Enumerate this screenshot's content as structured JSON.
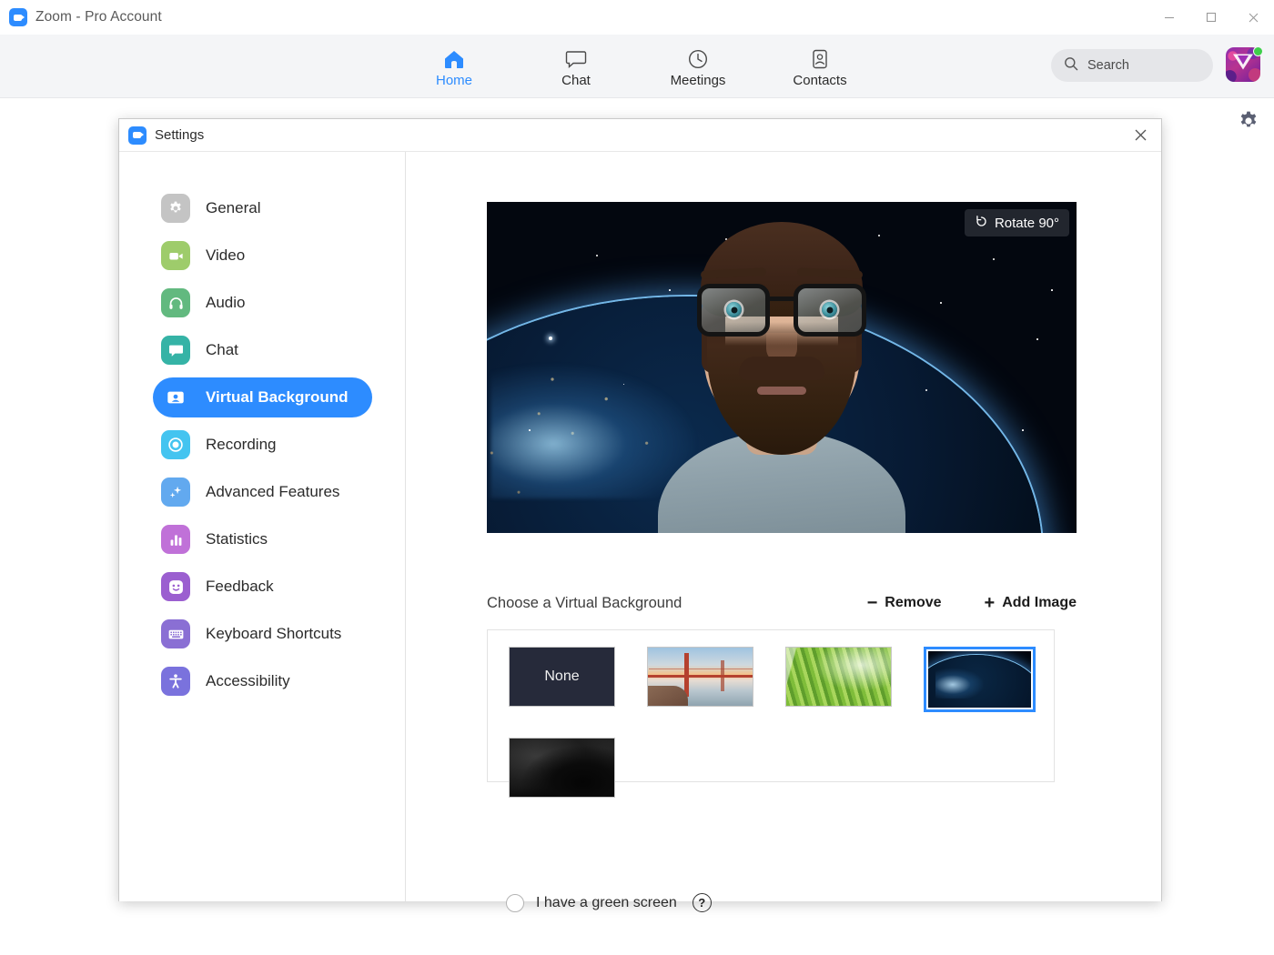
{
  "window": {
    "title": "Zoom - Pro Account",
    "minimize_label": "Minimize",
    "maximize_label": "Maximize",
    "close_label": "Close"
  },
  "nav": {
    "tabs": [
      {
        "label": "Home",
        "icon": "home-icon",
        "active": true
      },
      {
        "label": "Chat",
        "icon": "chat-bubble-icon",
        "active": false
      },
      {
        "label": "Meetings",
        "icon": "clock-icon",
        "active": false
      },
      {
        "label": "Contacts",
        "icon": "contact-card-icon",
        "active": false
      }
    ],
    "search": {
      "placeholder": "Search",
      "value": ""
    },
    "avatar": {
      "name": "user-avatar",
      "status": "available"
    },
    "gear_label": "Settings"
  },
  "dialog": {
    "title": "Settings",
    "close_label": "Close",
    "sidebar": [
      {
        "label": "General",
        "icon": "gear-icon",
        "color": "#c4c4c4",
        "active": false
      },
      {
        "label": "Video",
        "icon": "video-camera-icon",
        "color": "#9ecc6b",
        "active": false
      },
      {
        "label": "Audio",
        "icon": "headphones-icon",
        "color": "#62b97f",
        "active": false
      },
      {
        "label": "Chat",
        "icon": "chat-bubble-icon",
        "color": "#35b3a6",
        "active": false
      },
      {
        "label": "Virtual Background",
        "icon": "person-card-icon",
        "color": "#2D8CFF",
        "active": true
      },
      {
        "label": "Recording",
        "icon": "record-circle-icon",
        "color": "#44c4f0",
        "active": false
      },
      {
        "label": "Advanced Features",
        "icon": "sparkles-icon",
        "color": "#62a9ef",
        "active": false
      },
      {
        "label": "Statistics",
        "icon": "bar-chart-icon",
        "color": "#c071d8",
        "active": false
      },
      {
        "label": "Feedback",
        "icon": "smiley-face-icon",
        "color": "#9b5fd0",
        "active": false
      },
      {
        "label": "Keyboard Shortcuts",
        "icon": "keyboard-icon",
        "color": "#8a6fd4",
        "active": false
      },
      {
        "label": "Accessibility",
        "icon": "accessibility-icon",
        "color": "#7a72dd",
        "active": false
      }
    ],
    "preview": {
      "rotate_label": "Rotate 90°",
      "rotate_icon": "rotate-ccw-icon",
      "description": "Self-view video preview with space/Earth virtual background applied"
    },
    "choose_label": "Choose a Virtual Background",
    "remove": {
      "label": "Remove",
      "sign": "−"
    },
    "add_image": {
      "label": "Add Image",
      "sign": "+"
    },
    "backgrounds": [
      {
        "name": "none",
        "label": "None",
        "style": "thumb-none",
        "selected": false
      },
      {
        "name": "bridge",
        "label": "",
        "style": "thumb-bridge",
        "selected": false
      },
      {
        "name": "grass",
        "label": "",
        "style": "thumb-grass",
        "selected": false
      },
      {
        "name": "space",
        "label": "",
        "style": "thumb-space",
        "selected": true
      },
      {
        "name": "dark-smoke",
        "label": "",
        "style": "thumb-smoke",
        "selected": false
      }
    ],
    "green_screen": {
      "label": "I have a green screen",
      "checked": false,
      "help_label": "?"
    }
  },
  "colors": {
    "accent": "#2D8CFF",
    "navbar_bg": "#f4f5f7",
    "status_online": "#3ecf4a"
  }
}
